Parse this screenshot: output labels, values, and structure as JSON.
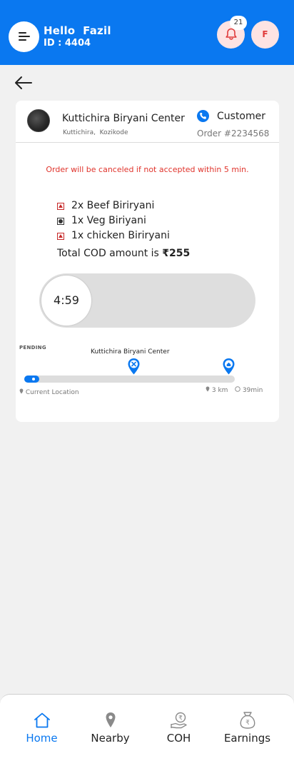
{
  "header": {
    "greeting": "Hello  Fazil",
    "user_id": "ID : 4404",
    "notification_count": "21",
    "avatar_initial": "F"
  },
  "order": {
    "restaurant_name": "Kuttichira Biryani Center",
    "restaurant_location": "Kuttichira,  Kozikode",
    "customer_label": "Customer",
    "order_number": "Order #2234568",
    "warning": "Order will be canceled if not accepted within 5 min.",
    "items": [
      {
        "label": "2x Beef Biriryani",
        "type": "non-veg"
      },
      {
        "label": "1x Veg Biriyani",
        "type": "veg"
      },
      {
        "label": "1x chicken Biriryani",
        "type": "non-veg"
      }
    ],
    "total_prefix": "Total COD amount is ",
    "total_amount": "₹255",
    "timer": "4:59"
  },
  "route": {
    "status": "PENDING",
    "midpoint_label": "Kuttichira Biryani Center",
    "current_location_label": "Current Location",
    "distance": "3 km",
    "duration": "39min",
    "progress": 0.07
  },
  "colors": {
    "primary": "#0a78f0",
    "warning": "#e0342c",
    "badge_bg": "#fde3e3"
  },
  "bottom_nav": {
    "items": [
      {
        "label": "Home",
        "icon": "home-icon",
        "active": true
      },
      {
        "label": "Nearby",
        "icon": "location-pin-icon",
        "active": false
      },
      {
        "label": "COH",
        "icon": "cash-in-hand-icon",
        "active": false
      },
      {
        "label": "Earnings",
        "icon": "money-bag-icon",
        "active": false
      }
    ]
  }
}
